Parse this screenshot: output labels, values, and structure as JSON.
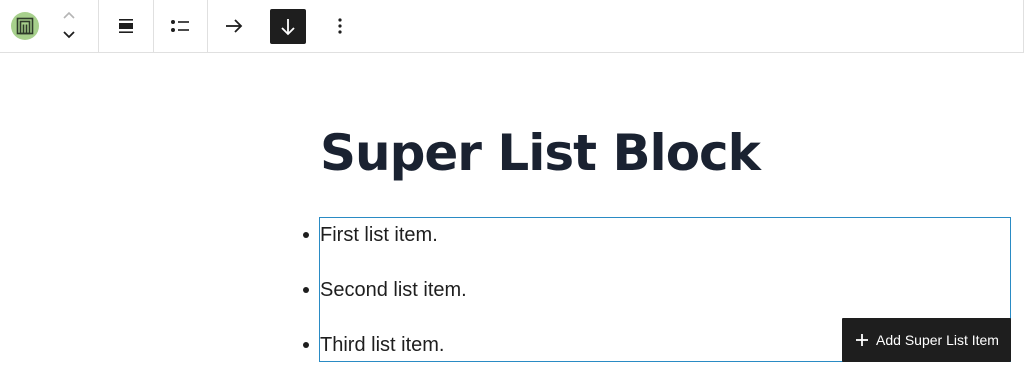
{
  "toolbar": {
    "block_icon": "super-list-block-icon",
    "move_up_icon": "chevron-up-icon",
    "move_down_icon": "chevron-down-icon",
    "align_icon": "align-icon",
    "list_style_icon": "unordered-list-icon",
    "orientation_horizontal_icon": "arrow-right-icon",
    "orientation_vertical_icon": "arrow-down-icon",
    "more_icon": "more-vertical-icon",
    "active_color": "#1e1e1e",
    "block_icon_color": "#a7d08c"
  },
  "content": {
    "title": "Super List Block",
    "items": [
      "First list item.",
      "Second list item.",
      "Third list item."
    ],
    "selection_color": "#2a8bc4"
  },
  "add_button": {
    "label": "Add Super List Item",
    "icon": "plus-icon"
  }
}
